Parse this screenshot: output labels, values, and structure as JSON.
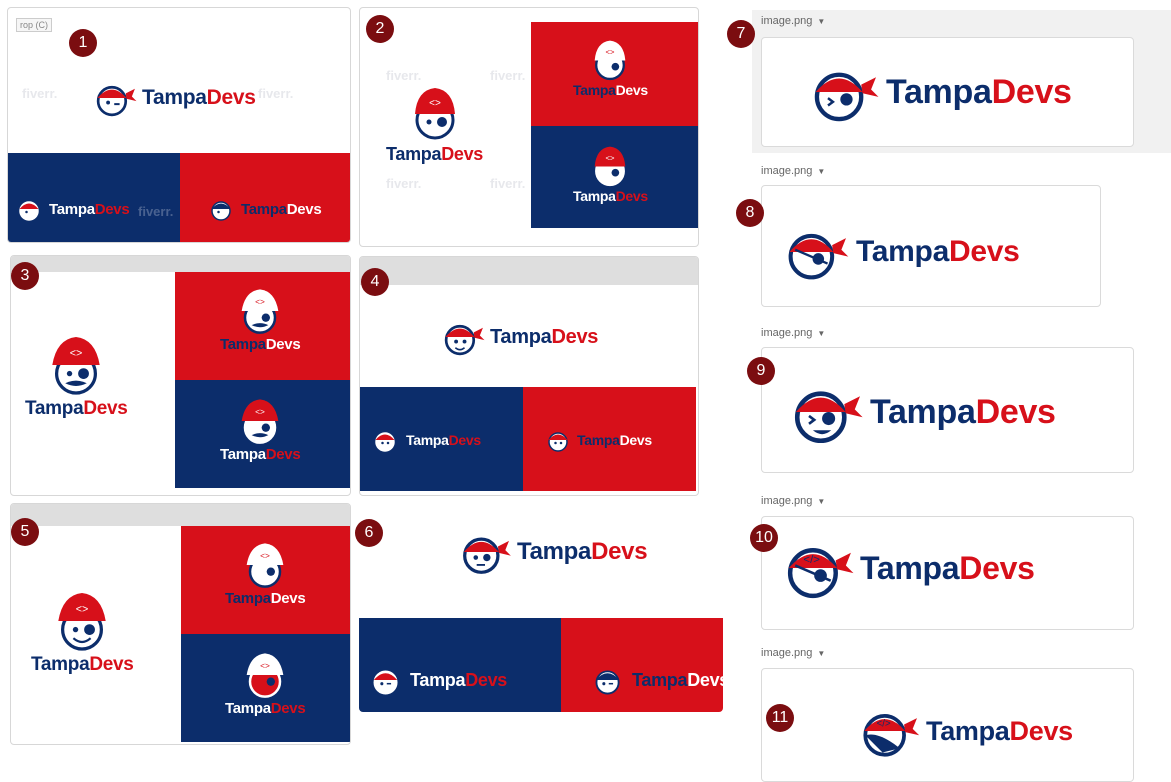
{
  "brand": {
    "word1": "Tampa",
    "word2": "Devs"
  },
  "colors": {
    "navy": "#0c2d6b",
    "red": "#d7101a",
    "badge": "#7b0d10"
  },
  "watermark": "fiverr.",
  "crop_label": "rop (C)",
  "badges": [
    "1",
    "2",
    "3",
    "4",
    "5",
    "6",
    "7",
    "8",
    "9",
    "10",
    "11"
  ],
  "attachments": [
    {
      "filename": "image.png"
    },
    {
      "filename": "image.png"
    },
    {
      "filename": "image.png"
    },
    {
      "filename": "image.png"
    },
    {
      "filename": "image.png"
    }
  ],
  "icons": [
    "pirate-mascot-icon",
    "dropdown-caret-icon"
  ]
}
